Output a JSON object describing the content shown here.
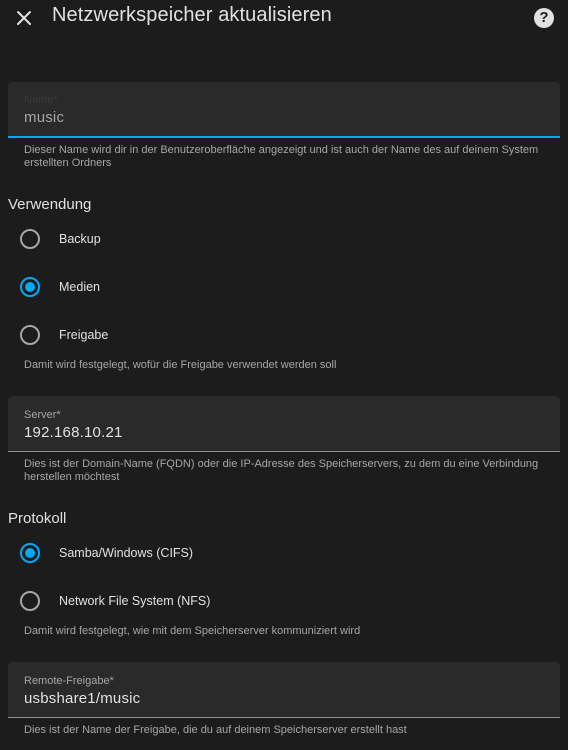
{
  "header": {
    "close_icon": "close-icon",
    "title": "Netzwerkspeicher aktualisieren",
    "help_icon": "help-icon",
    "help_glyph": "?"
  },
  "name_field": {
    "label": "Name*",
    "value": "music",
    "helper": "Dieser Name wird dir in der Benutzeroberfläche angezeigt und ist auch der Name des auf deinem System erstellten Ordners"
  },
  "usage": {
    "title": "Verwendung",
    "options": [
      {
        "label": "Backup",
        "checked": false
      },
      {
        "label": "Medien",
        "checked": true
      },
      {
        "label": "Freigabe",
        "checked": false
      }
    ],
    "helper": "Damit wird festgelegt, wofür die Freigabe verwendet werden soll"
  },
  "server_field": {
    "label": "Server*",
    "value": "192.168.10.21",
    "helper": "Dies ist der Domain-Name (FQDN) oder die IP-Adresse des Speicherservers, zu dem du eine Verbindung herstellen möchtest"
  },
  "protocol": {
    "title": "Protokoll",
    "options": [
      {
        "label": "Samba/Windows (CIFS)",
        "checked": true
      },
      {
        "label": "Network File System (NFS)",
        "checked": false
      }
    ],
    "helper": "Damit wird festgelegt, wie mit dem Speicherserver kommuniziert wird"
  },
  "remote_share_field": {
    "label": "Remote-Freigabe*",
    "value": "usbshare1/music",
    "helper": "Dies ist der Name der Freigabe, die du auf deinem Speicherserver erstellt hast"
  },
  "colors": {
    "background": "#1c1c1c",
    "field_background": "#2a2a2a",
    "accent": "#03a9f4",
    "text": "#e1e1e1",
    "secondary_text": "#a6a6a6"
  }
}
